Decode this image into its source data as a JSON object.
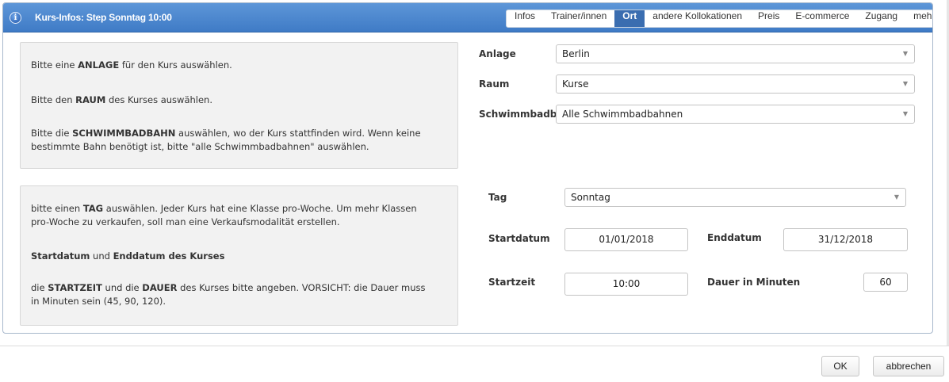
{
  "dialog": {
    "title": "Kurs-Infos: Step Sonntag 10:00",
    "info_icon": "i",
    "tabs": [
      {
        "label": "Infos"
      },
      {
        "label": "Trainer/innen"
      },
      {
        "label": "Ort",
        "active": true
      },
      {
        "label": "andere Kollokationen"
      },
      {
        "label": "Preis"
      },
      {
        "label": "E-commerce"
      },
      {
        "label": "Zugang"
      },
      {
        "label": "mehr"
      }
    ]
  },
  "help_location": {
    "line1_pre": "Bitte eine ",
    "line1_bold": "ANLAGE",
    "line1_post": " für den Kurs auswählen.",
    "line2_pre": "Bitte den ",
    "line2_bold": "RAUM",
    "line2_post": " des Kurses auswählen.",
    "line3_pre": "Bitte die ",
    "line3_bold": "SCHWIMMBADBAHN",
    "line3_post": " auswählen, wo der Kurs stattfinden wird. Wenn keine",
    "line3_cont": "bestimmte Bahn benötigt ist, bitte \"alle Schwimmbadbahnen\" auswählen."
  },
  "help_schedule": {
    "tag_pre": "bitte einen ",
    "tag_bold": "TAG",
    "tag_post": " auswählen. Jeder Kurs hat eine Klasse pro-Woche. Um mehr Klassen",
    "tag_cont": "pro-Woche zu verkaufen, soll man eine Verkaufsmodalität erstellen.",
    "dates_bold1": "Startdatum",
    "dates_mid": " und ",
    "dates_bold2": "Enddatum des Kurses",
    "time_pre": "die ",
    "time_bold1": "STARTZEIT",
    "time_mid": " und die ",
    "time_bold2": "DAUER",
    "time_post": " des Kurses bitte angeben. VORSICHT: die Dauer muss",
    "time_cont": "in Minuten sein (45, 90, 120)."
  },
  "location_form": {
    "anlage_label": "Anlage",
    "anlage_value": "Berlin",
    "raum_label": "Raum",
    "raum_value": "Kurse",
    "bahn_label": "Schwimmbadbahn",
    "bahn_value": "Alle Schwimmbadbahnen"
  },
  "schedule_form": {
    "tag_label": "Tag",
    "tag_value": "Sonntag",
    "startdatum_label": "Startdatum",
    "startdatum_value": "01/01/2018",
    "enddatum_label": "Enddatum",
    "enddatum_value": "31/12/2018",
    "startzeit_label": "Startzeit",
    "startzeit_value": "10:00",
    "dauer_label": "Dauer in Minuten",
    "dauer_value": "60"
  },
  "footer": {
    "ok_label": "OK",
    "cancel_label": "abbrechen"
  },
  "icons": {
    "dropdown": "▼"
  }
}
